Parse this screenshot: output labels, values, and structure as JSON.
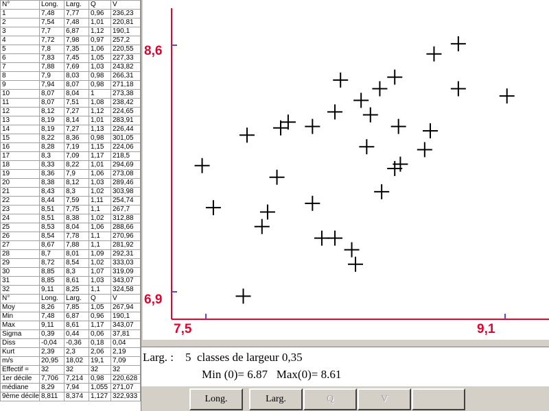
{
  "table": {
    "headers": [
      "N°",
      "Long.",
      "Larg.",
      "Q",
      "V"
    ],
    "rows": [
      [
        "1",
        "7,48",
        "7,77",
        "0,96",
        "236,23"
      ],
      [
        "2",
        "7,54",
        "7,48",
        "1,01",
        "220,81"
      ],
      [
        "3",
        "7,7",
        "6,87",
        "1,12",
        "190,1"
      ],
      [
        "4",
        "7,72",
        "7,98",
        "0,97",
        "257,2"
      ],
      [
        "5",
        "7,8",
        "7,35",
        "1,06",
        "220,55"
      ],
      [
        "6",
        "7,83",
        "7,45",
        "1,05",
        "227,33"
      ],
      [
        "7",
        "7,88",
        "7,69",
        "1,03",
        "243,82"
      ],
      [
        "8",
        "7,9",
        "8,03",
        "0,98",
        "266,31"
      ],
      [
        "9",
        "7,94",
        "8,07",
        "0,98",
        "271,18"
      ],
      [
        "10",
        "8,07",
        "8,04",
        "1",
        "273,38"
      ],
      [
        "11",
        "8,07",
        "7,51",
        "1,08",
        "238,42"
      ],
      [
        "12",
        "8,12",
        "7,27",
        "1,12",
        "224,65"
      ],
      [
        "13",
        "8,19",
        "8,14",
        "1,01",
        "283,91"
      ],
      [
        "14",
        "8,19",
        "7,27",
        "1,13",
        "226,44"
      ],
      [
        "15",
        "8,22",
        "8,36",
        "0,98",
        "301,05"
      ],
      [
        "16",
        "8,28",
        "7,19",
        "1,15",
        "224,06"
      ],
      [
        "17",
        "8,3",
        "7,09",
        "1,17",
        "218,5"
      ],
      [
        "18",
        "8,33",
        "8,22",
        "1,01",
        "294,69"
      ],
      [
        "19",
        "8,36",
        "7,9",
        "1,06",
        "273,08"
      ],
      [
        "20",
        "8,38",
        "8,12",
        "1,03",
        "289,46"
      ],
      [
        "21",
        "8,43",
        "8,3",
        "1,02",
        "303,98"
      ],
      [
        "22",
        "8,44",
        "7,59",
        "1,11",
        "254,74"
      ],
      [
        "23",
        "8,51",
        "7,75",
        "1,1",
        "267,7"
      ],
      [
        "24",
        "8,51",
        "8,38",
        "1,02",
        "312,88"
      ],
      [
        "25",
        "8,53",
        "8,04",
        "1,06",
        "288,66"
      ],
      [
        "26",
        "8,54",
        "7,78",
        "1,1",
        "270,96"
      ],
      [
        "27",
        "8,67",
        "7,88",
        "1,1",
        "281,92"
      ],
      [
        "28",
        "8,7",
        "8,01",
        "1,09",
        "292,31"
      ],
      [
        "29",
        "8,72",
        "8,54",
        "1,02",
        "333,03"
      ],
      [
        "30",
        "8,85",
        "8,3",
        "1,07",
        "319,09"
      ],
      [
        "31",
        "8,85",
        "8,61",
        "1,03",
        "343,07"
      ],
      [
        "32",
        "9,11",
        "8,25",
        "1,1",
        "324,58"
      ]
    ],
    "stats": [
      [
        "N°",
        "Long.",
        "Larg.",
        "Q",
        "V"
      ],
      [
        "Moy",
        "8,26",
        "7,85",
        "1,05",
        "267,94"
      ],
      [
        "Min",
        "7,48",
        "6,87",
        "0,96",
        "190,1"
      ],
      [
        "Max",
        "9,11",
        "8,61",
        "1,17",
        "343,07"
      ],
      [
        "Sigma",
        "0,39",
        "0,44",
        "0,06",
        "37,81"
      ],
      [
        "Diss",
        "-0,04",
        "-0,36",
        "0,18",
        "0,04"
      ],
      [
        "Kurt",
        "2,39",
        "2,3",
        "2,06",
        "2,19"
      ],
      [
        "m/s",
        "20,95",
        "18,02",
        "19,1",
        "7,09"
      ],
      [
        "Effectif =",
        "32",
        "32",
        "32",
        "32"
      ],
      [
        "1er décile",
        "7,706",
        "7,214",
        "0,98",
        "220,628"
      ],
      [
        "médiane",
        "8,29",
        "7,94",
        "1,055",
        "271,07"
      ],
      [
        "9ème décile",
        "8,811",
        "8,374",
        "1,127",
        "322,933"
      ]
    ]
  },
  "chart_data": {
    "type": "scatter",
    "title": "",
    "xlabel": "",
    "ylabel": "",
    "xlim": [
      7.5,
      9.1
    ],
    "ylim": [
      6.9,
      8.6
    ],
    "x_tick_labels": [
      "7,5",
      "9,1"
    ],
    "y_tick_labels": [
      "8,6",
      "6,9"
    ],
    "axis_color": "#e8002c",
    "marker": "cross",
    "marker_color": "#000000",
    "grid": false,
    "x": [
      7.48,
      7.54,
      7.7,
      7.72,
      7.8,
      7.83,
      7.88,
      7.9,
      7.94,
      8.07,
      8.07,
      8.12,
      8.19,
      8.19,
      8.22,
      8.28,
      8.3,
      8.33,
      8.36,
      8.38,
      8.43,
      8.44,
      8.51,
      8.51,
      8.53,
      8.54,
      8.67,
      8.7,
      8.72,
      8.85,
      8.85,
      9.11
    ],
    "y": [
      7.77,
      7.48,
      6.87,
      7.98,
      7.35,
      7.45,
      7.69,
      8.03,
      8.07,
      8.04,
      7.51,
      7.27,
      8.14,
      7.27,
      8.36,
      7.19,
      7.09,
      8.22,
      7.9,
      8.12,
      8.3,
      7.59,
      7.75,
      8.38,
      8.04,
      7.78,
      7.88,
      8.01,
      8.54,
      8.3,
      8.61,
      8.25
    ]
  },
  "info": {
    "line1": "Larg. :    5  classes de largeur 0,35",
    "line2": "Min (0)= 6.87   Max(0)= 8.61"
  },
  "buttons": {
    "long": "Long.",
    "larg": "Larg.",
    "q": "Q",
    "v": "V",
    "blank": ""
  }
}
